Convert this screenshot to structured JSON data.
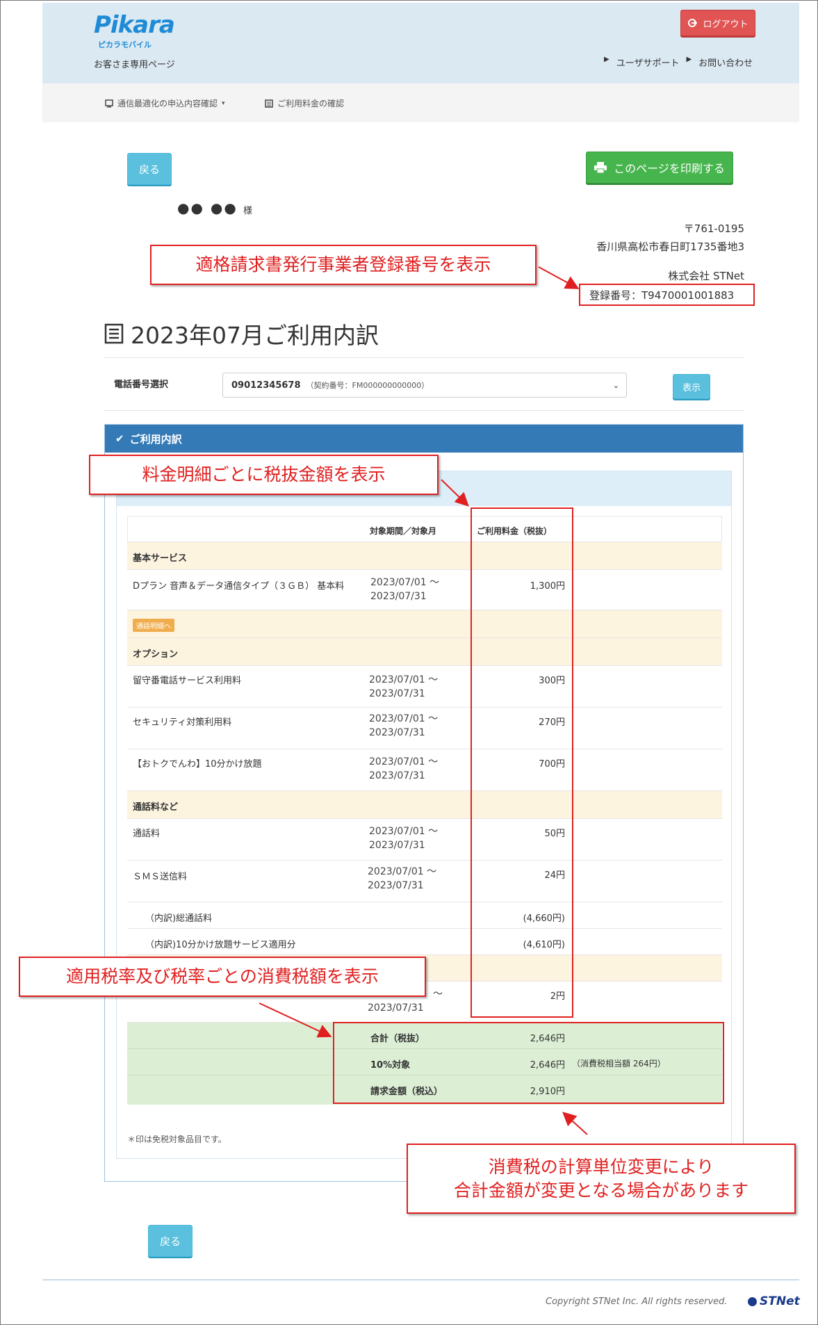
{
  "header": {
    "logo": "Pikara",
    "logo_sub": "ピカラモバイル",
    "customer_page": "お客さま専用ページ",
    "logout": "ログアウト",
    "links": [
      "ユーザサポート",
      "お問い合わせ"
    ]
  },
  "subnav": {
    "item1": "通信最適化の申込内容確認",
    "item2": "ご利用料金の確認"
  },
  "buttons": {
    "back": "戻る",
    "print": "このページを印刷する",
    "show": "表示"
  },
  "customer": {
    "name": "●● ●●",
    "honorific": "様"
  },
  "company": {
    "postal": "〒761-0195",
    "address": "香川県高松市春日町1735番地3",
    "name": "株式会社 STNet",
    "reg_no": "登録番号：T9470001001883"
  },
  "page_title": "2023年07月ご利用内訳",
  "phone_select": {
    "label": "電話番号選択",
    "number": "09012345678",
    "contract": "（契約番号：FM000000000000）"
  },
  "panel_title": "ご利用内訳",
  "table": {
    "headers": [
      "対象期間／対象月",
      "ご利用料金（税抜）"
    ],
    "sec_basic": "基本サービス",
    "basic_item": "Dプラン 音声＆データ通信タイプ（３ＧＢ） 基本料",
    "basic_date1": "2023/07/01 〜",
    "basic_date2": "2023/07/31",
    "basic_amt": "1,300円",
    "call_detail_btn": "通話明細へ",
    "sec_option": "オプション",
    "opt": [
      {
        "name": "留守番電話サービス利用料",
        "d1": "2023/07/01 〜",
        "d2": "2023/07/31",
        "amt": "300円"
      },
      {
        "name": "セキュリティ対策利用料",
        "d1": "2023/07/01 〜",
        "d2": "2023/07/31",
        "amt": "270円"
      },
      {
        "name": "【おトクでんわ】10分かけ放題",
        "d1": "2023/07/01 〜",
        "d2": "2023/07/31",
        "amt": "700円"
      }
    ],
    "sec_calls": "通話料など",
    "calls": [
      {
        "name": "通話料",
        "d1": "2023/07/01 〜",
        "d2": "2023/07/31",
        "amt": "50円"
      },
      {
        "name": "ＳＭＳ送信料",
        "d1": "2023/07/01 〜",
        "d2": "2023/07/31",
        "amt": "24円"
      }
    ],
    "sub1_name": "（内訳)総通話料",
    "sub1_amt": "(4,660円)",
    "sub2_name": "（内訳)10分かけ放題サービス適用分",
    "sub2_amt": "(4,610円)",
    "last_d1": "〜",
    "last_d2": "2023/07/31",
    "last_amt": "2円"
  },
  "totals": {
    "r1_label": "合計（税抜）",
    "r1_amt": "2,646円",
    "r2_label": "10%対象",
    "r2_amt": "2,646円",
    "r2_note": "（消費税相当額 264円）",
    "r3_label": "請求金額（税込）",
    "r3_amt": "2,910円"
  },
  "note": "＊印は免税対象品目です。",
  "callouts": {
    "c1": "適格請求書発行事業者登録番号を表示",
    "c2": "料金明細ごとに税抜金額を表示",
    "c3": "適用税率及び税率ごとの消費税額を表示",
    "c4a": "消費税の計算単位変更により",
    "c4b": "合計金額が変更となる場合があります"
  },
  "copyright": "Copyright STNet Inc. All rights reserved.",
  "footer_logo": "STNet",
  "colors": {
    "header_bg": "#dbe9f3",
    "logout": "#e05454",
    "print": "#47b54d",
    "accent_blue": "#337ab7",
    "callout_red": "#e02020",
    "section_bg": "#fdf4e0",
    "totals_bg": "#dcefd5"
  }
}
